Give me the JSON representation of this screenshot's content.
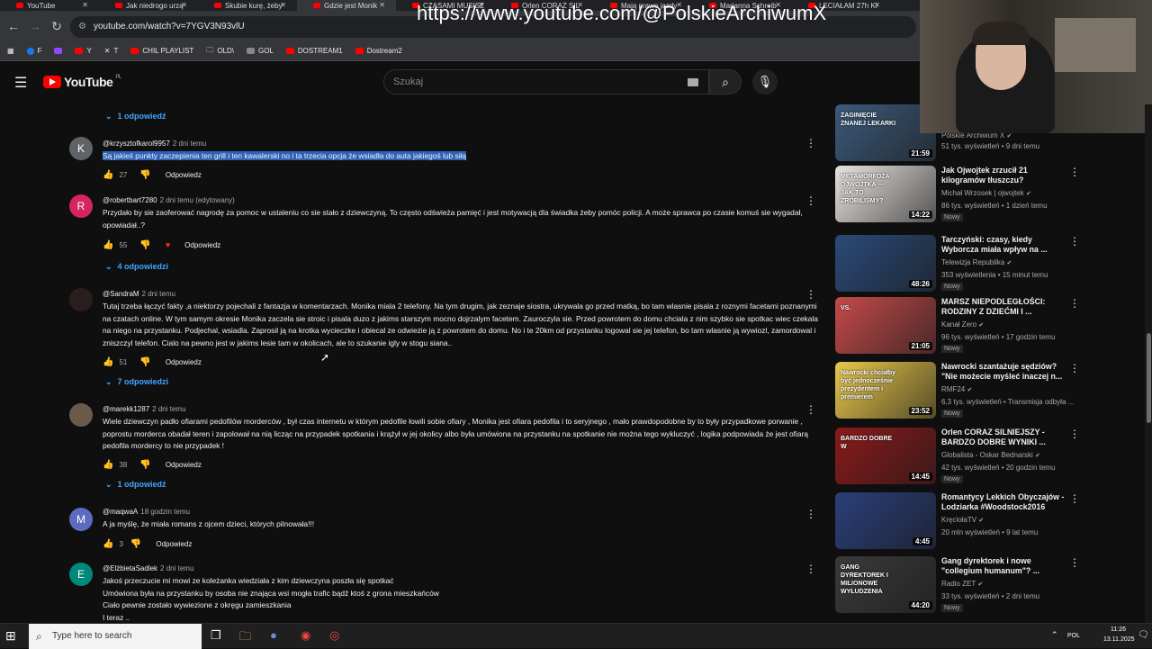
{
  "browser": {
    "tabs": [
      {
        "label": "YouTube",
        "active": false
      },
      {
        "label": "Jak niedrogo urzą",
        "active": false
      },
      {
        "label": "Skubie kurę, żeby",
        "active": false
      },
      {
        "label": "Gdzie jest Monik",
        "active": true
      },
      {
        "label": "CZASAMI MUSISZ",
        "active": false
      },
      {
        "label": "Orlen CORAZ SIL",
        "active": false
      },
      {
        "label": "Mają prawo jazdy",
        "active": false
      },
      {
        "label": "Marianna Schreib",
        "active": false
      },
      {
        "label": "LECIAŁAM 27h KI",
        "active": false
      }
    ],
    "url": "youtube.com/watch?v=7YGV3N93vlU",
    "bookmarks": [
      "F",
      "Y",
      "T",
      "CHIL PLAYLIST",
      "OLD\\",
      "GOL",
      "DOSTREAM1",
      "Dostream2"
    ]
  },
  "watermark": "https://www.youtube.com/@PolskieArchiwumX",
  "youtube": {
    "logo_text": "YouTube",
    "logo_region": "PL",
    "search_placeholder": "Szukaj"
  },
  "comments": [
    {
      "replies_before": "1 odpowiedź",
      "author": "@krzysztofkarol9957",
      "time": "2 dni temu",
      "avatar_letter": "K",
      "avatar_color": "#5f6368",
      "text": "Są jakieś punkty zaczepienia ten grill i ten kawalerski no i ta trzecia opcja że wsiadła do auta jakiegoś lub siłą",
      "highlighted": true,
      "likes": "27",
      "reply_label": "Odpowiedz"
    },
    {
      "author": "@robertbart7280",
      "time": "2 dni temu (edytowany)",
      "avatar_letter": "R",
      "avatar_color": "#d6245e",
      "text": "Przydało by sie zaoferować nagrodę za pomoc w ustaleniu co sie stało z dziewczyną. To często odświeża pamięć i jest motywacją dla świadka żeby pomóc policji. A może sprawca po czasie komuś sie wygadał, opowiadał..?",
      "likes": "55",
      "reply_label": "Odpowiedz",
      "replies": "4 odpowiedzi"
    },
    {
      "author": "@SandraM",
      "time": "2 dni temu",
      "avatar_letter": "",
      "avatar_color": "#2a1e1e",
      "text": "Tutaj trzeba łączyć fakty ,a niektorzy pojechali z fantazja w komentarzach. Monika miala 2 telefony. Na tym drugim, jak zeznaje siostra, ukrywala go przed matką, bo tam wlasnie pisala z roznymi facetami poznanymi na czatach online. W tym samym okresie Monika zaczela sie stroic i pisala duzo z jakims starszym mocno dojrzalym facetem. Zauroczyla sie. Przed powrotem do domu chciala z nim szybko sie spotkac wiec czekala na niego na przystanku. Podjechal, wsiadla. Zaprosil ją na krotka wycieczke i obiecal ze odwiezie ją z powrotem do domu. No i te 20km od przystanku logowal sie jej telefon, bo tam wlasnie ją wywiozl, zamordowal i zniszczyl telefon. Cialo na pewno jest w jakims lesie tam w okolicach, ale to szukanie igly w stogu siana..",
      "likes": "51",
      "reply_label": "Odpowiedz",
      "replies": "7 odpowiedzi"
    },
    {
      "author": "@marekk1287",
      "time": "2 dni temu",
      "avatar_letter": "",
      "avatar_color": "#6b5a4a",
      "text": "Wiele dziewczyn padło ofiarami pedofilów morderców , był czas internetu w którym pedofile łowili sobie ofiary , Monika jest ofiara pedofila i to seryjnego , mało prawdopodobne by to były przypadkowe porwanie , poprostu morderca obadał teren  i zapolował na nią licząc na przypadek spotkania i krążył w jej okolicy albo była umówiona na przystanku na spotkanie nie można tego wykluczyć , logika podpowiada że jest ofiarą pedofila mordercy to nie przypadek !",
      "likes": "38",
      "reply_label": "Odpowiedz",
      "replies": "1 odpowiedź"
    },
    {
      "author": "@maqwaA",
      "time": "18 godzin temu",
      "avatar_letter": "M",
      "avatar_color": "#5c6bc0",
      "text": "A ja myślę, że miała romans z ojcem dzieci, których pilnowała!!!",
      "likes": "3",
      "reply_label": "Odpowiedz"
    },
    {
      "author": "@ElżbietaSadlek",
      "time": "2 dni temu",
      "avatar_letter": "E",
      "avatar_color": "#00897b",
      "text_lines": [
        "Jakoś przeczucie mi mowi ze koleżanka wiedziała z kim dziewczyna poszła się spotkać",
        "Umówiona była na przystanku by osoba nie znająca wsi mogła trafic bądź ktoś z grona mieszkańców",
        "Ciało pewnie zostało wywiezione z okręgu zamieszkania",
        "I teraz .."
      ]
    }
  ],
  "recommended": [
    {
      "title": "",
      "channel": "Polskie Archiwum X",
      "stats": "51 tys. wyświetleń • 9 dni temu",
      "duration": "21:59",
      "thumb_caption": "ZAGINIĘCIE ZNANEJ LEKARKI",
      "thumb_color": "#3b5a7a",
      "badge": ""
    },
    {
      "title": "Jak Ojwojtek zrzucił 21 kilogramów tłuszczu?",
      "channel": "Michał Wrzosek | ojwojtek",
      "stats": "86 tys. wyświetleń • 1 dzień temu",
      "duration": "14:22",
      "thumb_caption": "METAMORFOZA OJWOJTKA — JAK TO ZROBILIŚMY?",
      "thumb_color": "#e8e4e0",
      "badge": "Nowy"
    },
    {
      "title": "Tarczyński: czasy, kiedy Wyborcza miała wpływ na ...",
      "channel": "Telewizja Republika",
      "stats": "353 wyświetlenia • 15 minut temu",
      "duration": "48:26",
      "thumb_caption": "",
      "thumb_color": "#2a4a78",
      "badge": "Nowy"
    },
    {
      "title": "MARSZ NIEPODLEGŁOŚCI: RODZINY Z DZIEĆMI I ...",
      "channel": "Kanał Zero",
      "stats": "96 tys. wyświetleń • 17 godzin temu",
      "duration": "21:05",
      "thumb_caption": "VS.",
      "thumb_color": "#c44a4a",
      "badge": "Nowy"
    },
    {
      "title": "Nawrocki szantażuje sędziów? \"Nie możecie myśleć inaczej n...",
      "channel": "RMF24",
      "stats": "6,3 tys. wyświetleń • Transmisja odbyła ...",
      "duration": "23:52",
      "thumb_caption": "Nawrocki chciałby być jednocześnie prezydentem i premierem",
      "thumb_color": "#e8c84a",
      "badge": "Nowy"
    },
    {
      "title": "Orlen CORAZ SILNIEJSZY - BARDZO DOBRE WYNIKI ...",
      "channel": "Globalista - Oskar Bednarski",
      "stats": "42 tys. wyświetleń • 20 godzin temu",
      "duration": "14:45",
      "thumb_caption": "BARDZO DOBRE W",
      "thumb_color": "#8a1a1a",
      "badge": "Nowy"
    },
    {
      "title": "Romantycy Lekkich Obyczajów - Lodziarka #Woodstock2016",
      "channel": "KręciołaTV",
      "stats": "20 mln wyświetleń • 9 lat temu",
      "duration": "4:45",
      "thumb_caption": "",
      "thumb_color": "#2a3f7a",
      "badge": ""
    },
    {
      "title": "Gang dyrektorek i nowe \"collegium humanum\"? ...",
      "channel": "Radio ZET",
      "stats": "33 tys. wyświetleń • 2 dni temu",
      "duration": "44:20",
      "thumb_caption": "GANG DYREKTOREK I MILIONOWE WYŁUDZENIA",
      "thumb_color": "#3a3a3a",
      "badge": "Nowy"
    }
  ],
  "taskbar": {
    "search_placeholder": "Type here to search",
    "language": "POL",
    "time": "11:26",
    "date": "13.11.2025"
  },
  "colors": {
    "accent_link": "#3ea6ff",
    "youtube_red": "#ff0000",
    "highlight": "#2e62b8"
  }
}
